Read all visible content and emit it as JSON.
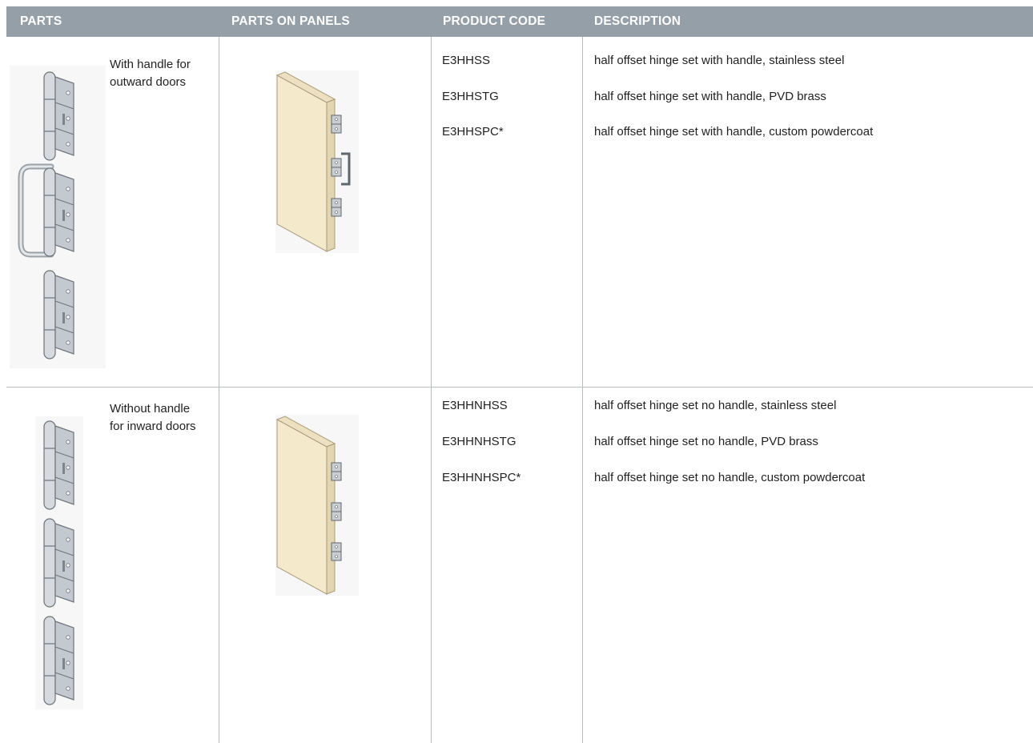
{
  "headers": {
    "parts": "PARTS",
    "parts_on_panels": "PARTS ON PANELS",
    "product_code": "PRODUCT CODE",
    "description": "DESCRIPTION"
  },
  "rows": [
    {
      "part_label_line1": "With handle for",
      "part_label_line2": "outward doors",
      "parts_image": "hinge-set-with-handle",
      "panel_image": "door-panel-with-handle",
      "items": [
        {
          "code": "E3HHSS",
          "description": "half offset hinge set with handle, stainless steel"
        },
        {
          "code": "E3HHSTG",
          "description": "half offset hinge set with handle, PVD brass"
        },
        {
          "code": "E3HHSPC*",
          "description": "half offset hinge set with handle, custom powdercoat"
        }
      ]
    },
    {
      "part_label_line1": "Without handle",
      "part_label_line2": "for inward doors",
      "parts_image": "hinge-set-no-handle",
      "panel_image": "door-panel-no-handle",
      "items": [
        {
          "code": "E3HHNHSS",
          "description": "half offset hinge set no handle, stainless steel"
        },
        {
          "code": "E3HHNHSTG",
          "description": "half offset hinge set no handle, PVD brass"
        },
        {
          "code": "E3HHNHSPC*",
          "description": "half offset hinge set no handle, custom powdercoat"
        }
      ]
    }
  ],
  "colors": {
    "header_bg": "#959fa8",
    "grid_line": "#b7bcc1",
    "panel_fill": "#f5e9cc",
    "hinge_fill": "#c9ced3"
  }
}
